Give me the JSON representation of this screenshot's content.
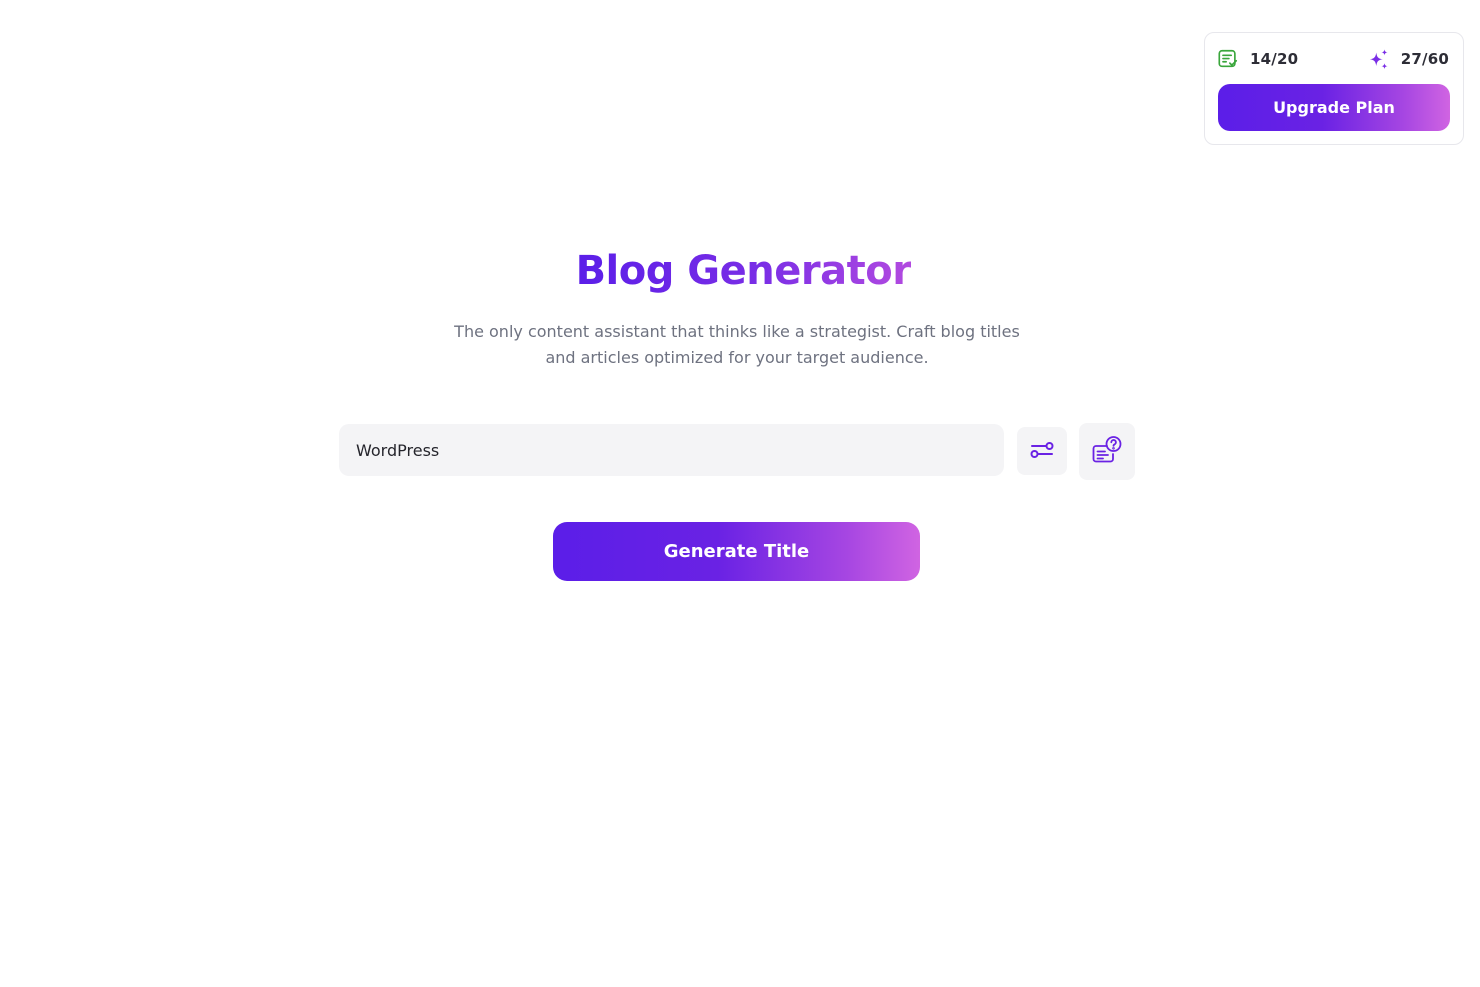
{
  "usage": {
    "titles": {
      "icon": "document-check-icon",
      "count": "14/20",
      "color": "#3aa63c"
    },
    "credits": {
      "icon": "sparkles-icon",
      "count": "27/60",
      "color": "#7a2ee6"
    },
    "upgrade_label": "Upgrade Plan"
  },
  "hero": {
    "title": "Blog Generator",
    "subtitle": "The only content assistant that thinks like a strategist. Craft blog titles and articles optimized for your target audience."
  },
  "input": {
    "value": "WordPress"
  },
  "actions": {
    "settings_icon": "sliders-icon",
    "help_icon": "document-question-icon",
    "generate_label": "Generate Title"
  },
  "colors": {
    "accent_start": "#5b1ee8",
    "accent_end": "#d064e2"
  }
}
